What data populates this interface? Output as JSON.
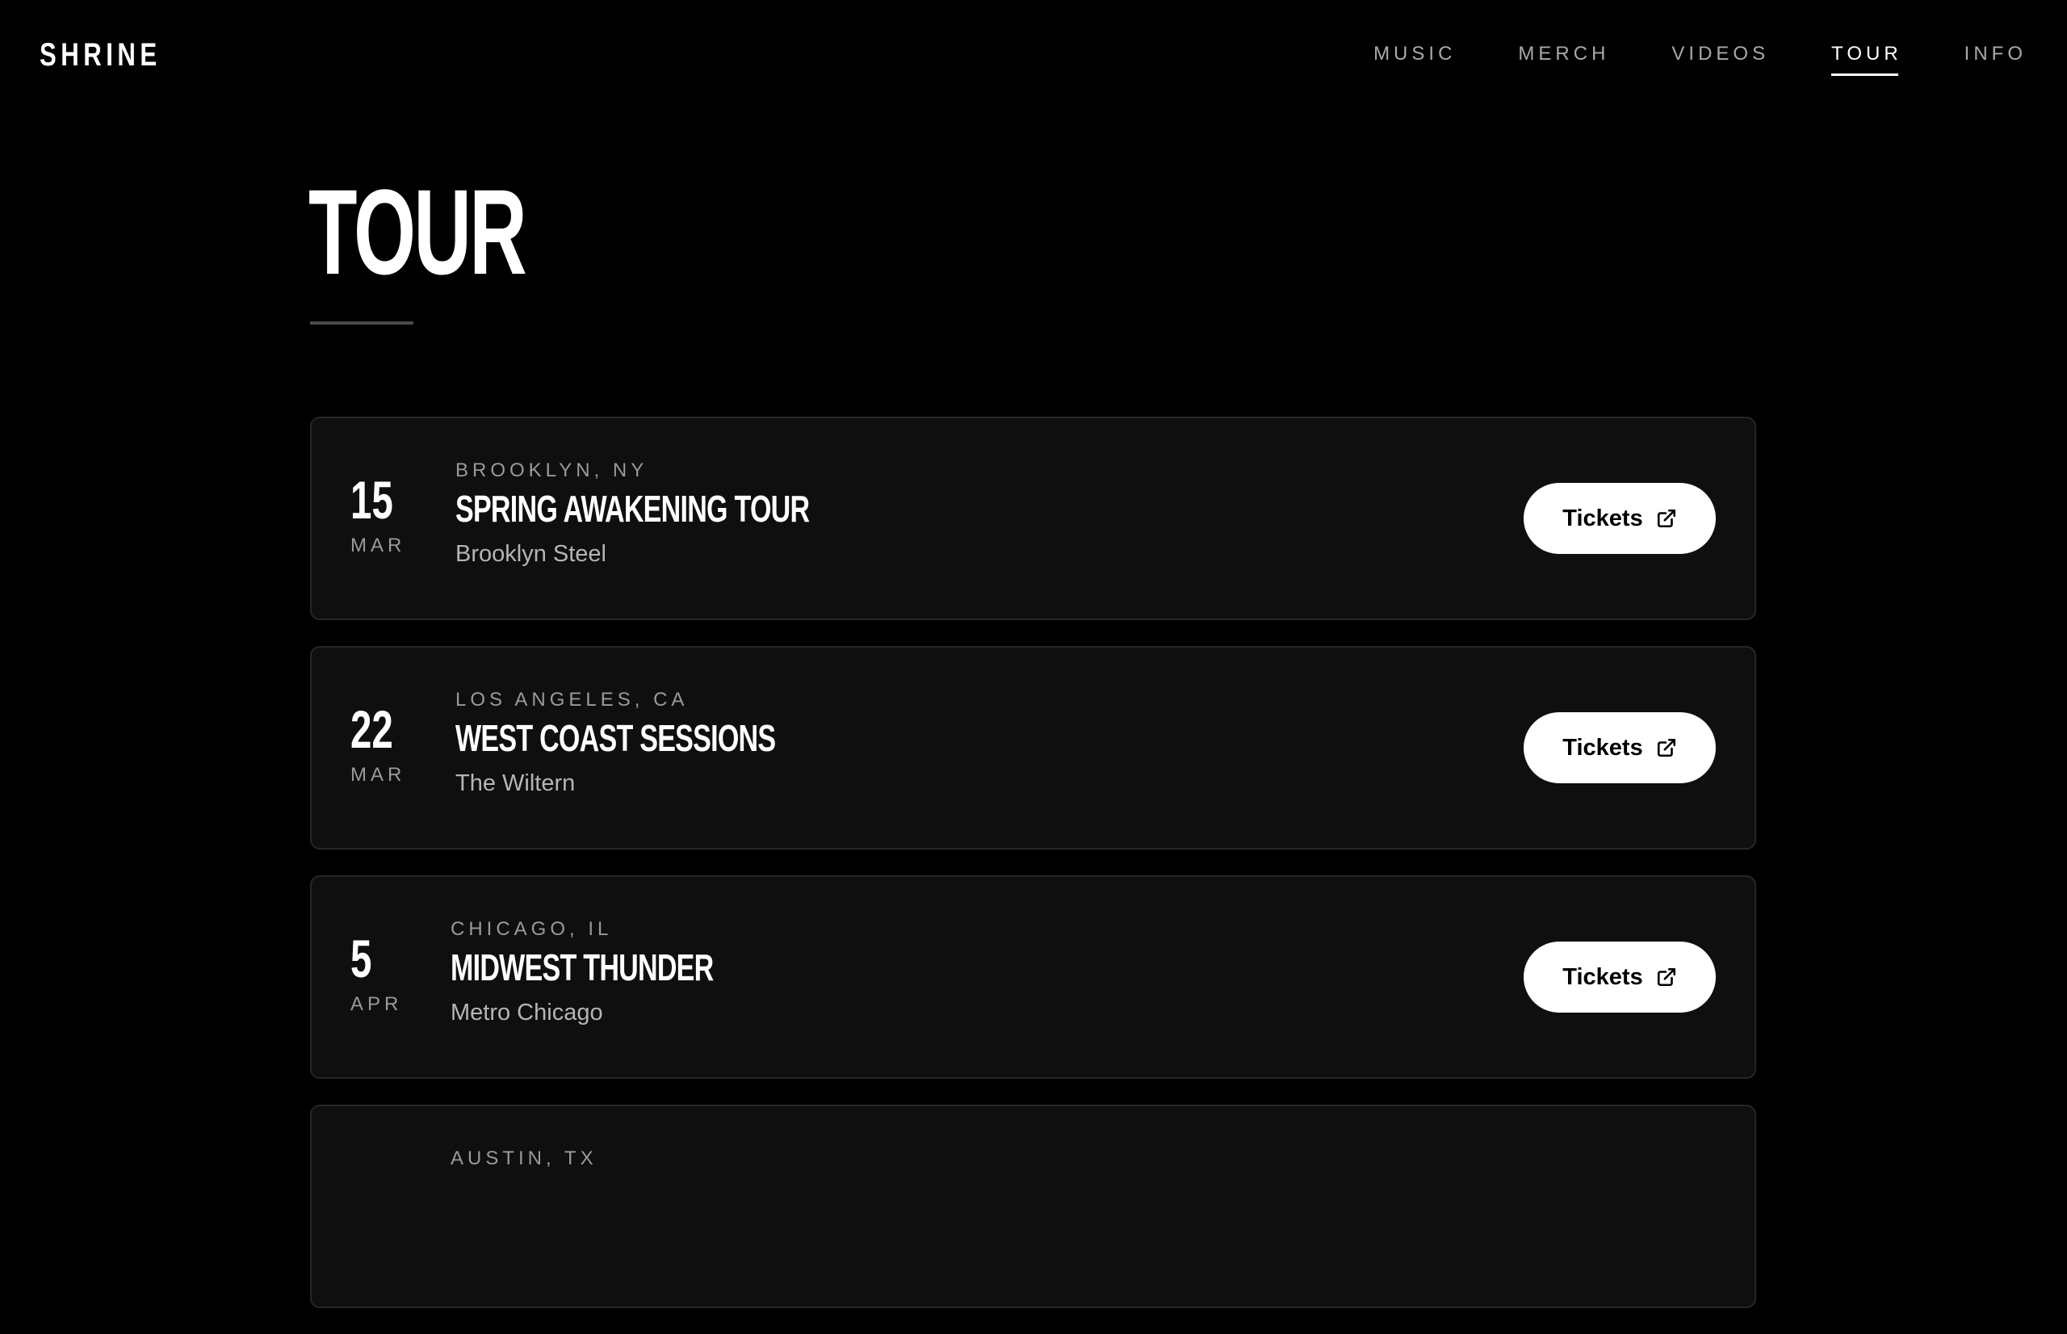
{
  "brand": {
    "logo_text": "SHRINE"
  },
  "nav": {
    "items": [
      {
        "label": "MUSIC",
        "active": false
      },
      {
        "label": "MERCH",
        "active": false
      },
      {
        "label": "VIDEOS",
        "active": false
      },
      {
        "label": "TOUR",
        "active": true
      },
      {
        "label": "INFO",
        "active": false
      }
    ]
  },
  "page": {
    "title": "TOUR"
  },
  "events": [
    {
      "day": "15",
      "month": "MAR",
      "city": "BROOKLYN, NY",
      "tour": "SPRING AWAKENING TOUR",
      "venue": "Brooklyn Steel",
      "button_label": "Tickets"
    },
    {
      "day": "22",
      "month": "MAR",
      "city": "LOS ANGELES, CA",
      "tour": "WEST COAST SESSIONS",
      "venue": "The Wiltern",
      "button_label": "Tickets"
    },
    {
      "day": "5",
      "month": "APR",
      "city": "CHICAGO, IL",
      "tour": "MIDWEST THUNDER",
      "venue": "Metro Chicago",
      "button_label": "Tickets"
    },
    {
      "day": "",
      "month": "",
      "city": "AUSTIN, TX",
      "tour": "",
      "venue": "",
      "button_label": ""
    }
  ],
  "icons": {
    "ticket_link": "external-link-icon"
  },
  "colors": {
    "background": "#000000",
    "card": "#0f0f0f",
    "accent": "#ffffff"
  }
}
